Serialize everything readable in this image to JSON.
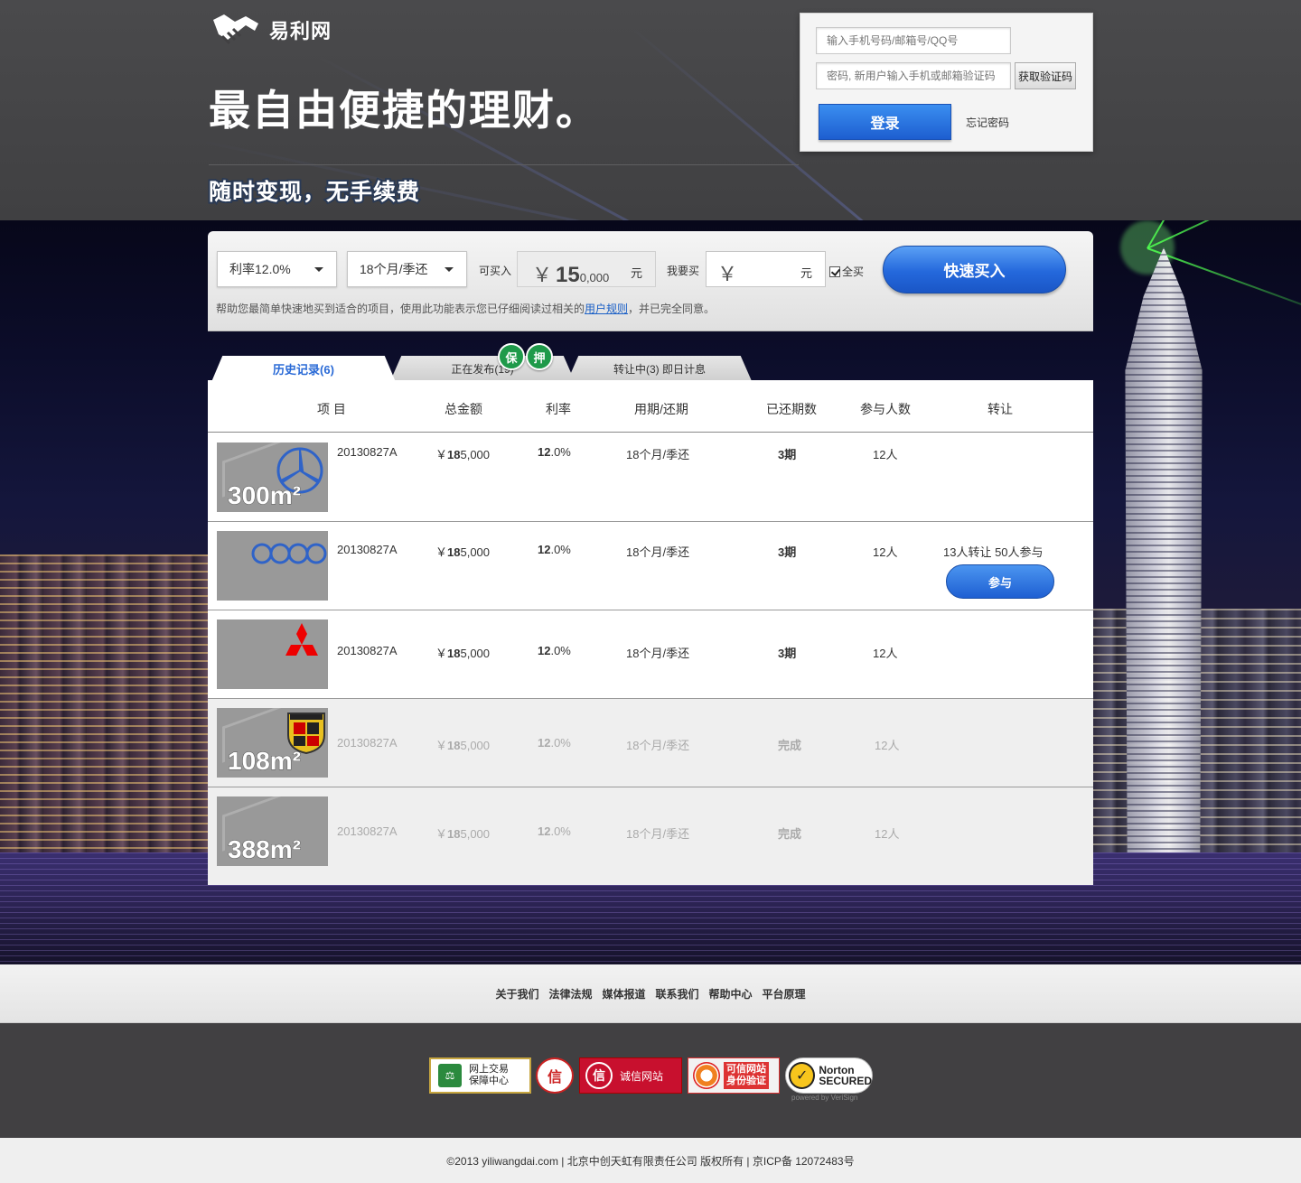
{
  "brand": {
    "name": "易利网",
    "slogan": "最自由便捷的理财。",
    "sub_slogan": "随时变现，无手续费"
  },
  "login": {
    "username_placeholder": "输入手机号码/邮箱号/QQ号",
    "password_placeholder": "密码, 新用户输入手机或邮箱验证码",
    "get_code_label": "获取验证码",
    "login_label": "登录",
    "forgot_label": "忘记密码"
  },
  "quick_buy": {
    "rate_select": "利率12.0%",
    "term_select": "18个月/季还",
    "available_label": "可买入",
    "available_yen": "￥",
    "available_big": "15",
    "available_small": "0,000",
    "available_unit": "元",
    "want_label": "我要买",
    "amount_yen": "￥",
    "amount_unit": "元",
    "all_label": "全买",
    "all_checked": true,
    "buy_label": "快速买入",
    "help_prefix": "帮助您最简单快速地买到适合的项目，使用此功能表示您已仔细阅读过相关的",
    "help_link": "用户规则",
    "help_suffix": "，并已完全同意。"
  },
  "tabs": [
    {
      "label": "历史记录(6)",
      "active": true
    },
    {
      "label": "正在发布(19)",
      "active": false
    },
    {
      "label": "转让中(3) 即日计息",
      "active": false
    }
  ],
  "badges": [
    "保",
    "押"
  ],
  "table": {
    "headers": [
      "项 目",
      "总金额",
      "利率",
      "用期/还期",
      "已还期数",
      "参与人数",
      "转让"
    ],
    "rows": [
      {
        "thumb": "300m²",
        "logo": "mercedes-logo",
        "code": "20130827A",
        "amount_prefix": "￥",
        "amount_bold": "18",
        "amount_rest": "5,000",
        "rate_bold": "12",
        "rate_rest": ".0%",
        "term": "18个月/季还",
        "paid": "3期",
        "people": "12人",
        "transfer": "",
        "done": false
      },
      {
        "thumb": "",
        "logo": "audi-logo",
        "code": "20130827A",
        "amount_prefix": "￥",
        "amount_bold": "18",
        "amount_rest": "5,000",
        "rate_bold": "12",
        "rate_rest": ".0%",
        "term": "18个月/季还",
        "paid": "3期",
        "people": "12人",
        "transfer": "13人转让  50人参与",
        "join_label": "参与",
        "done": false
      },
      {
        "thumb": "",
        "logo": "mitsubishi-logo",
        "code": "20130827A",
        "amount_prefix": "￥",
        "amount_bold": "18",
        "amount_rest": "5,000",
        "rate_bold": "12",
        "rate_rest": ".0%",
        "term": "18个月/季还",
        "paid": "3期",
        "people": "12人",
        "transfer": "",
        "done": false
      },
      {
        "thumb": "108m²",
        "logo": "porsche-logo",
        "code": "20130827A",
        "amount_prefix": "￥",
        "amount_bold": "18",
        "amount_rest": "5,000",
        "rate_bold": "12",
        "rate_rest": ".0%",
        "term": "18个月/季还",
        "paid": "完成",
        "people": "12人",
        "transfer": "",
        "done": true
      },
      {
        "thumb": "388m²",
        "logo": "",
        "code": "20130827A",
        "amount_prefix": "￥",
        "amount_bold": "18",
        "amount_rest": "5,000",
        "rate_bold": "12",
        "rate_rest": ".0%",
        "term": "18个月/季还",
        "paid": "完成",
        "people": "12人",
        "transfer": "",
        "done": true
      }
    ]
  },
  "footer": {
    "links": [
      "关于我们",
      "法律法规",
      "媒体报道",
      "联系我们",
      "帮助中心",
      "平台原理"
    ],
    "trust_badges": [
      {
        "text": "网上交易\n保障中心"
      },
      {
        "text": "信"
      },
      {
        "text": "诚信网站"
      },
      {
        "text": "可信网站\n身份验证"
      },
      {
        "text": "Norton\nSECURED"
      }
    ],
    "norton_powered": "powered by VeriSign",
    "copyright": "©2013 yiliwangdai.com | 北京中创天虹有限责任公司 版权所有 | 京ICP备 12072483号"
  },
  "colors": {
    "accent_blue": "#2468dc",
    "badge_green": "#1f9a4a",
    "header_bg": "#414042"
  }
}
